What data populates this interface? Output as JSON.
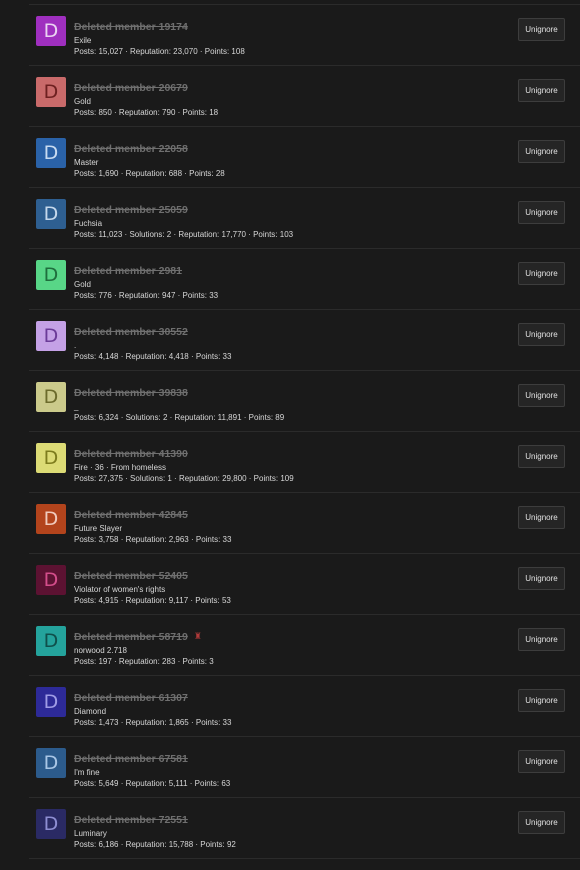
{
  "members": [
    {
      "initial": "D",
      "name": "Deleted member 19174",
      "title": "Exile",
      "stats": "Posts: 15,027 · Reputation: 23,070 · Points: 108",
      "bg": "#9f2fbf",
      "fg": "#ead4f2",
      "button": "Unignore"
    },
    {
      "initial": "D",
      "name": "Deleted member 20679",
      "title": "Gold",
      "stats": "Posts: 850 · Reputation: 790 · Points: 18",
      "bg": "#c96a6a",
      "fg": "#6e2020",
      "button": "Unignore"
    },
    {
      "initial": "D",
      "name": "Deleted member 22058",
      "title": "Master",
      "stats": "Posts: 1,690 · Reputation: 688 · Points: 28",
      "bg": "#2a62a8",
      "fg": "#c8dbf1",
      "button": "Unignore"
    },
    {
      "initial": "D",
      "name": "Deleted member 25059",
      "title": "Fuchsia",
      "stats": "Posts: 11,023 · Solutions: 2 · Reputation: 17,770 · Points: 103",
      "bg": "#2e5f91",
      "fg": "#c5d8ec",
      "button": "Unignore"
    },
    {
      "initial": "D",
      "name": "Deleted member 2981",
      "title": "Gold",
      "stats": "Posts: 776 · Reputation: 947 · Points: 33",
      "bg": "#58d687",
      "fg": "#1f6e3d",
      "button": "Unignore"
    },
    {
      "initial": "D",
      "name": "Deleted member 30552",
      "title": ".",
      "stats": "Posts: 4,148 · Reputation: 4,418 · Points: 33",
      "bg": "#c4a1e6",
      "fg": "#6b3b98",
      "button": "Unignore"
    },
    {
      "initial": "D",
      "name": "Deleted member 39838",
      "title": "_",
      "stats": "Posts: 6,324 · Solutions: 2 · Reputation: 11,891 · Points: 89",
      "bg": "#cbca8b",
      "fg": "#6c6b2c",
      "button": "Unignore"
    },
    {
      "initial": "D",
      "name": "Deleted member 41390",
      "title": "Fire · 36 · From homeless",
      "stats": "Posts: 27,375 · Solutions: 1 · Reputation: 29,800 · Points: 109",
      "bg": "#dcdb75",
      "fg": "#7d7c1d",
      "button": "Unignore"
    },
    {
      "initial": "D",
      "name": "Deleted member 42845",
      "title": "Future Slayer",
      "stats": "Posts: 3,758 · Reputation: 2,963 · Points: 33",
      "bg": "#b3441c",
      "fg": "#f0cbbd",
      "button": "Unignore"
    },
    {
      "initial": "D",
      "name": "Deleted member 52405",
      "title": "Violator of women's rights",
      "stats": "Posts: 4,915 · Reputation: 9,117 · Points: 53",
      "bg": "#5c1232",
      "fg": "#d44e8b",
      "button": "Unignore"
    },
    {
      "initial": "D",
      "name": "Deleted member 58719",
      "title": "norwood 2.718",
      "stats": "Posts: 197 · Reputation: 283 · Points: 3",
      "bg": "#24a39c",
      "fg": "#0f4f4b",
      "button": "Unignore",
      "badge": "♜"
    },
    {
      "initial": "D",
      "name": "Deleted member 61307",
      "title": "Diamond",
      "stats": "Posts: 1,473 · Reputation: 1,865 · Points: 33",
      "bg": "#2d2a98",
      "fg": "#9f9ce6",
      "button": "Unignore"
    },
    {
      "initial": "D",
      "name": "Deleted member 67581",
      "title": "I'm fine",
      "stats": "Posts: 5,649 · Reputation: 5,111 · Points: 63",
      "bg": "#2c5b8c",
      "fg": "#a9c6e6",
      "button": "Unignore"
    },
    {
      "initial": "D",
      "name": "Deleted member 72551",
      "title": "Luminary",
      "stats": "Posts: 6,186 · Reputation: 15,788 · Points: 92",
      "bg": "#2a2a64",
      "fg": "#8e8ed2",
      "button": "Unignore"
    }
  ]
}
